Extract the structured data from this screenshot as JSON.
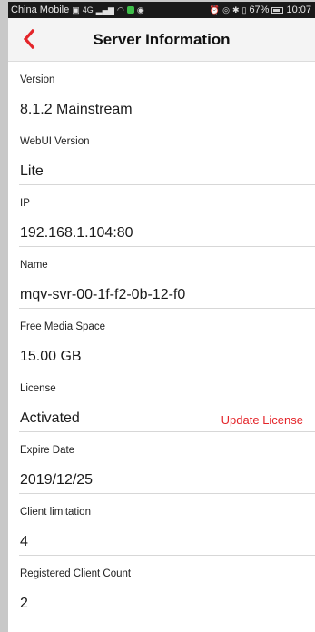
{
  "status_bar": {
    "carrier": "China Mobile",
    "signal_text": "4G",
    "battery": "67%",
    "time": "10:07"
  },
  "header": {
    "title": "Server Information"
  },
  "accent_color": "#e4252a",
  "fields": [
    {
      "label": "Version",
      "value": "8.1.2 Mainstream"
    },
    {
      "label": "WebUI Version",
      "value": "Lite"
    },
    {
      "label": "IP",
      "value": "192.168.1.104:80"
    },
    {
      "label": "Name",
      "value": "mqv-svr-00-1f-f2-0b-12-f0"
    },
    {
      "label": "Free Media Space",
      "value": "15.00 GB"
    },
    {
      "label": "License",
      "value": "Activated",
      "action": "Update License"
    },
    {
      "label": "Expire Date",
      "value": "2019/12/25"
    },
    {
      "label": "Client limitation",
      "value": "4"
    },
    {
      "label": "Registered Client Count",
      "value": "2"
    }
  ]
}
